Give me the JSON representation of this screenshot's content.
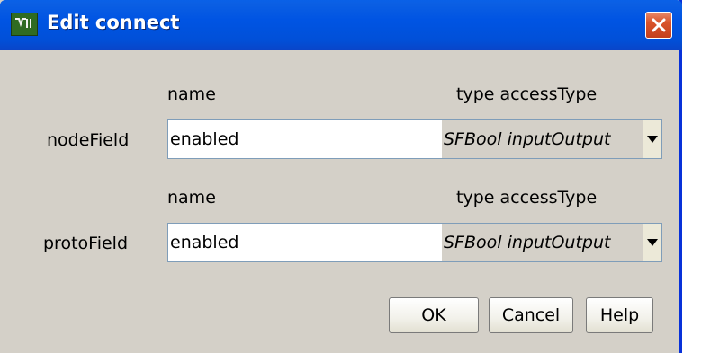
{
  "window": {
    "title": "Edit connect"
  },
  "node_field": {
    "row_label": "nodeField",
    "name_header": "name",
    "type_header": "type accessType",
    "name_value": "enabled",
    "type_value": "SFBool inputOutput"
  },
  "proto_field": {
    "row_label": "protoField",
    "name_header": "name",
    "type_header": "type accessType",
    "name_value": "enabled",
    "type_value": "SFBool inputOutput"
  },
  "buttons": {
    "ok": "OK",
    "cancel": "Cancel",
    "help_first": "H",
    "help_rest": "elp"
  },
  "icons": {
    "app": "vrml-editor-icon",
    "close": "close-icon",
    "dropdown": "chevron-down-icon"
  },
  "colors": {
    "titlebar": "#0054e3",
    "dialog_bg": "#d4d0c8",
    "close_button": "#d9532a"
  }
}
